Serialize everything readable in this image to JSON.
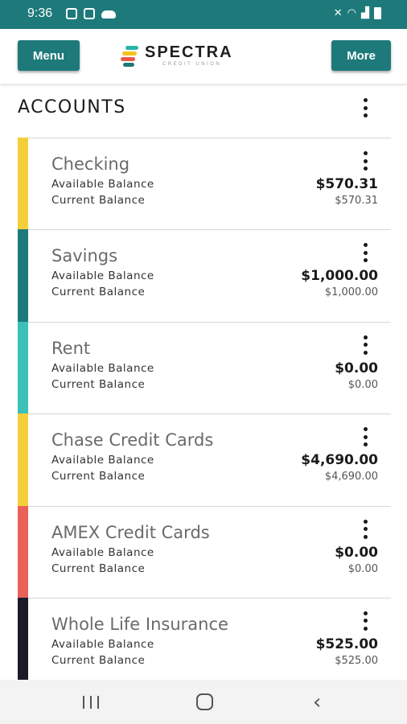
{
  "status_bar": {
    "time": "9:36"
  },
  "header": {
    "menu_label": "Menu",
    "more_label": "More",
    "logo_name": "SPECTRA",
    "logo_sub": "CREDIT UNION",
    "logo_colors": [
      "#2bb3a8",
      "#f5c21b",
      "#e8574a",
      "#1e7a7a"
    ]
  },
  "accounts": {
    "title": "ACCOUNTS",
    "items": [
      {
        "name": "Checking",
        "available_label": "Available Balance",
        "current_label": "Current Balance",
        "available": "$570.31",
        "current": "$570.31",
        "color": "#f5cf3a"
      },
      {
        "name": "Savings",
        "available_label": "Available Balance",
        "current_label": "Current Balance",
        "available": "$1,000.00",
        "current": "$1,000.00",
        "color": "#1e7a7a"
      },
      {
        "name": "Rent",
        "available_label": "Available Balance",
        "current_label": "Current Balance",
        "available": "$0.00",
        "current": "$0.00",
        "color": "#3cc0b8"
      },
      {
        "name": "Chase Credit Cards",
        "available_label": "Available Balance",
        "current_label": "Current Balance",
        "available": "$4,690.00",
        "current": "$4,690.00",
        "color": "#f5cf3a"
      },
      {
        "name": "AMEX Credit Cards",
        "available_label": "Available Balance",
        "current_label": "Current Balance",
        "available": "$0.00",
        "current": "$0.00",
        "color": "#e8625a"
      },
      {
        "name": "Whole Life Insurance",
        "available_label": "Available Balance",
        "current_label": "Current Balance",
        "available": "$525.00",
        "current": "$525.00",
        "color": "#1c1a2a"
      }
    ]
  },
  "colors": {
    "brand": "#1e7a7a"
  },
  "nav_icons": [
    "recents-icon",
    "home-icon",
    "back-icon"
  ]
}
